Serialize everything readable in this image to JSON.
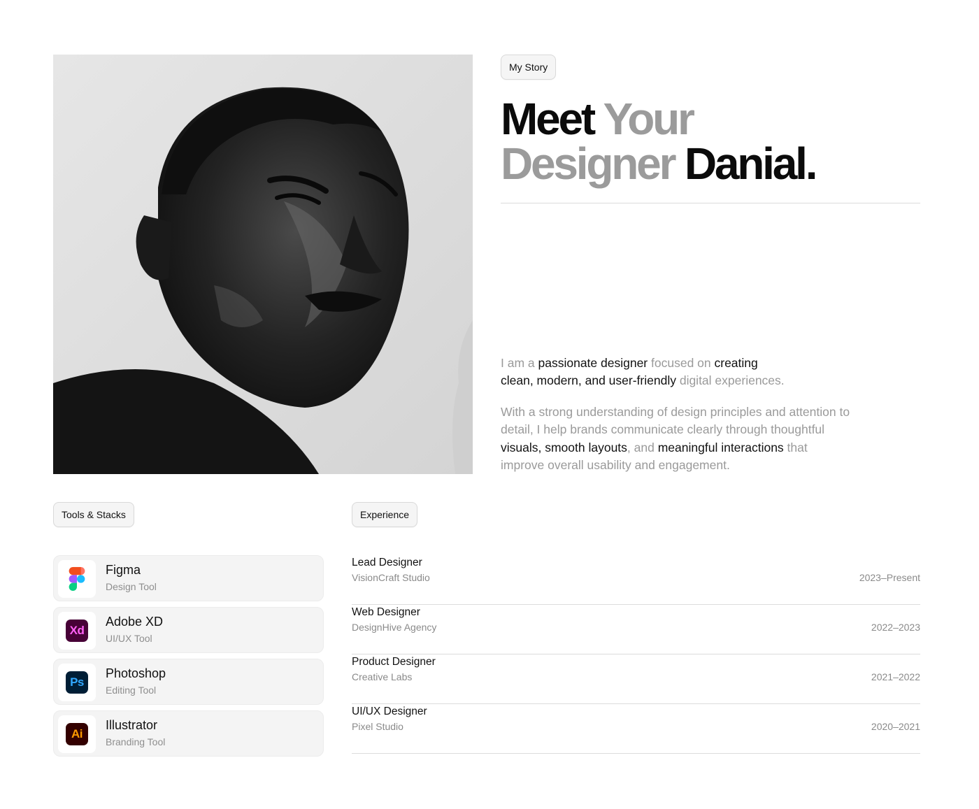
{
  "story_tag": "My Story",
  "headline": {
    "part1": "Meet",
    "part2": "Your",
    "part3": "Designer",
    "part4": "Danial."
  },
  "intro": {
    "s1": "I am a ",
    "s2": "passionate designer",
    "s3": " focused on ",
    "s4": "creating",
    "s5": "clean, modern, and user-friendly",
    "s6": " digital experiences."
  },
  "detail": {
    "s1": "With a strong understanding of design principles and attention to detail, I help brands communicate clearly through thoughtful ",
    "s2": "visuals, smooth layouts",
    "s3": ", and ",
    "s4": "meaningful interactions",
    "s5": " that improve overall usability and engagement."
  },
  "tools_tag": "Tools & Stacks",
  "tools": [
    {
      "name": "Figma",
      "type": "Design Tool",
      "icon": "figma-icon"
    },
    {
      "name": "Adobe XD",
      "type": "UI/UX Tool",
      "icon": "adobe-xd-icon",
      "icon_text": "Xd",
      "bg": "#470137",
      "fg": "#ff61f6"
    },
    {
      "name": "Photoshop",
      "type": "Editing Tool",
      "icon": "photoshop-icon",
      "icon_text": "Ps",
      "bg": "#001e36",
      "fg": "#31a8ff"
    },
    {
      "name": "Illustrator",
      "type": "Branding Tool",
      "icon": "illustrator-icon",
      "icon_text": "Ai",
      "bg": "#330000",
      "fg": "#ff9a00"
    }
  ],
  "experience_tag": "Experience",
  "experience": [
    {
      "role": "Lead Designer",
      "company": "VisionCraft Studio",
      "years": "2023–Present"
    },
    {
      "role": "Web Designer",
      "company": "DesignHive Agency",
      "years": "2022–2023"
    },
    {
      "role": "Product Designer",
      "company": "Creative Labs",
      "years": "2021–2022"
    },
    {
      "role": "UI/UX Designer",
      "company": "Pixel Studio",
      "years": "2020–2021"
    }
  ]
}
